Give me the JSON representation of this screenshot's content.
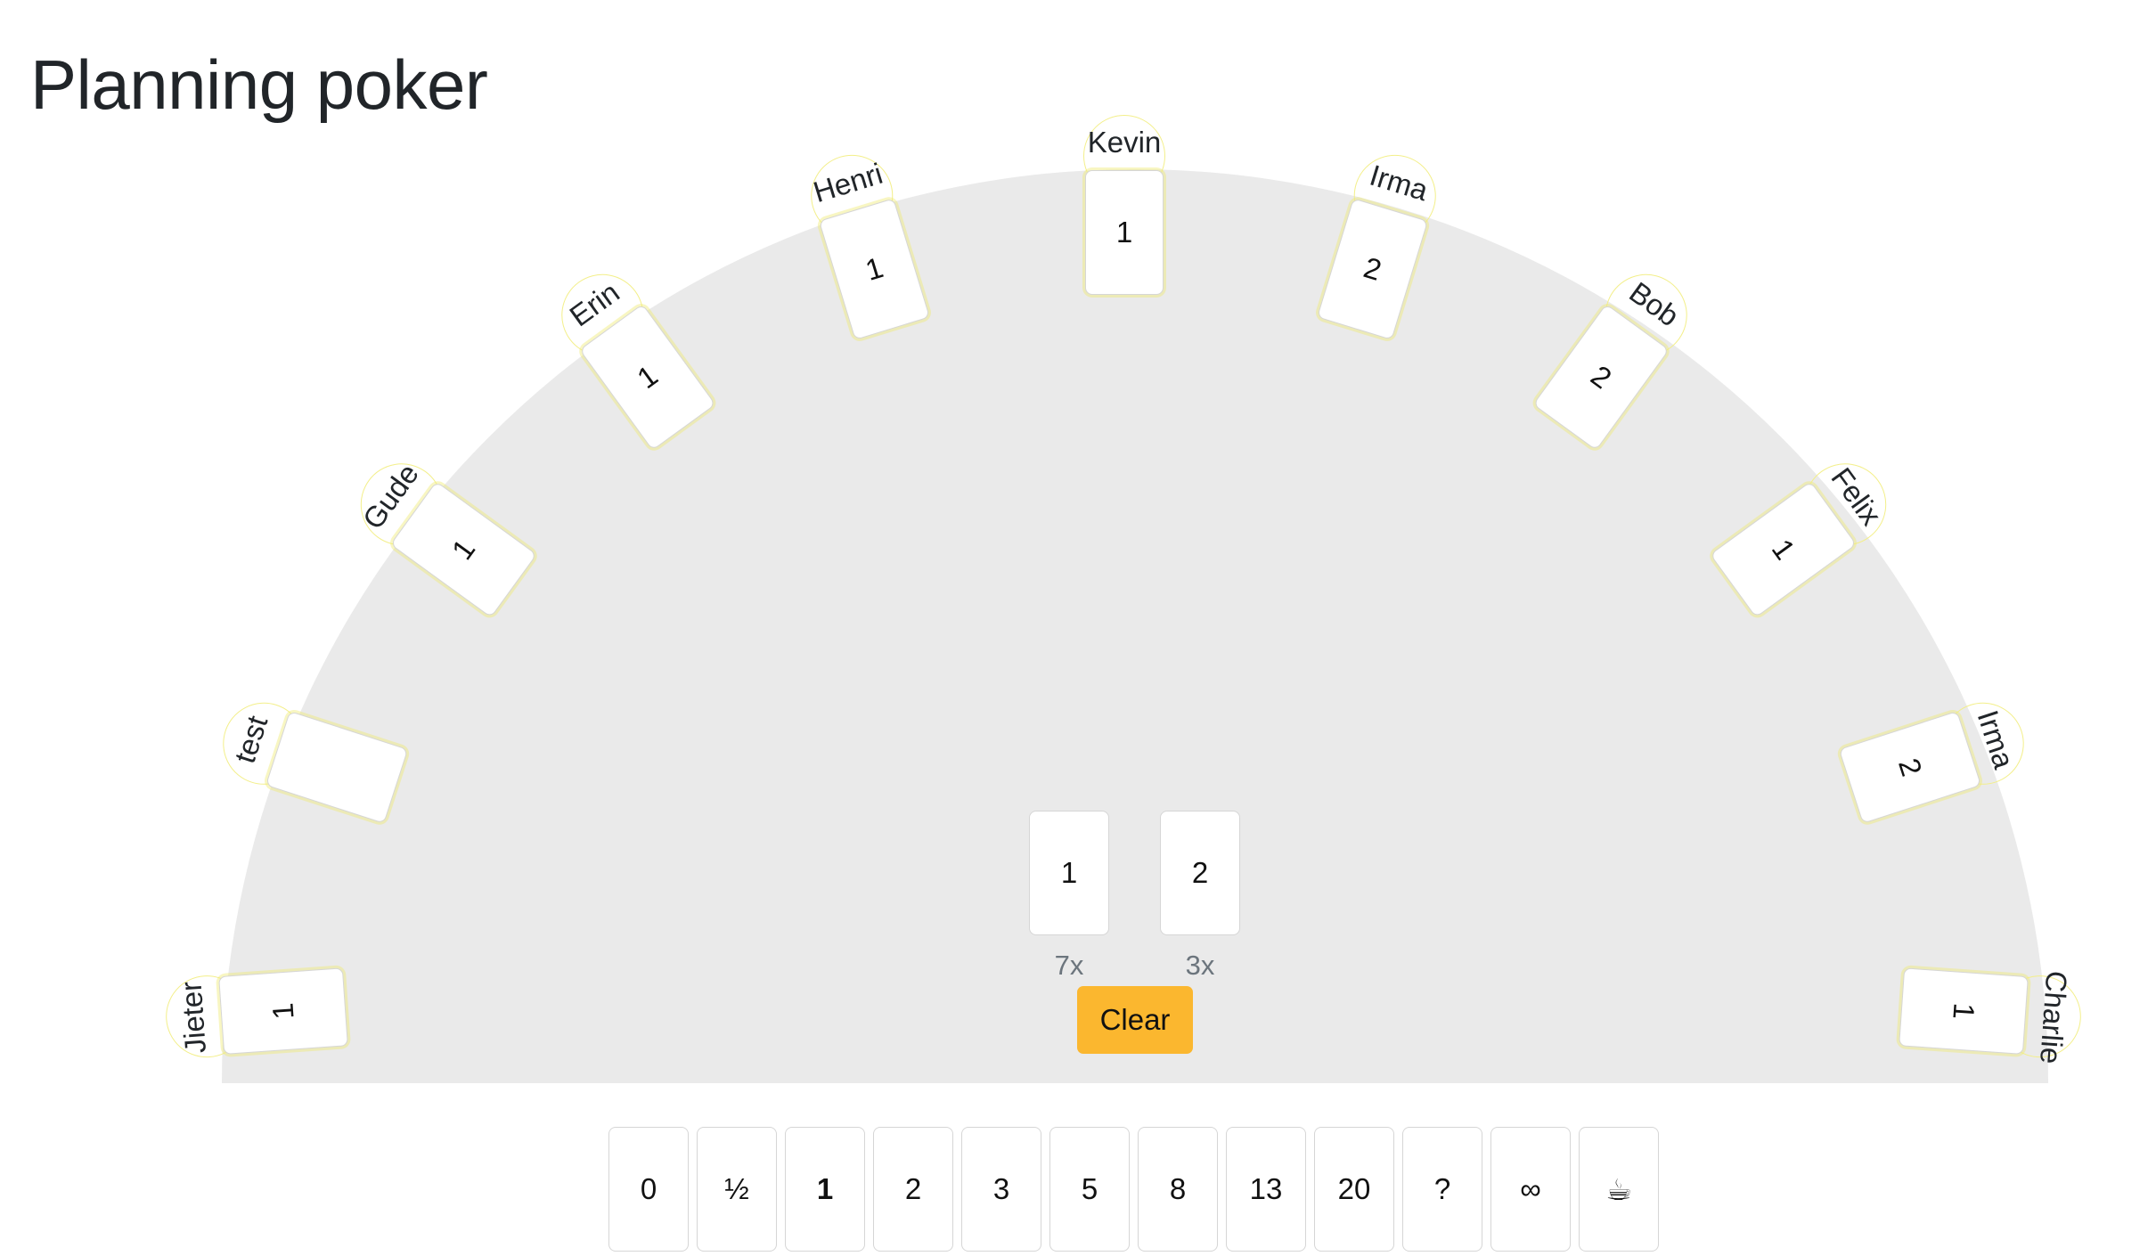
{
  "app": {
    "title": "Planning poker"
  },
  "players": [
    {
      "name": "Jieter",
      "vote": "1"
    },
    {
      "name": "test",
      "vote": ""
    },
    {
      "name": "Gude",
      "vote": "1"
    },
    {
      "name": "Erin",
      "vote": "1"
    },
    {
      "name": "Henri",
      "vote": "1"
    },
    {
      "name": "Kevin",
      "vote": "1"
    },
    {
      "name": "Irma",
      "vote": "2"
    },
    {
      "name": "Bob",
      "vote": "2"
    },
    {
      "name": "Felix",
      "vote": "1"
    },
    {
      "name": "Irma",
      "vote": "2"
    },
    {
      "name": "Charlie",
      "vote": "1"
    }
  ],
  "summary": {
    "results": [
      {
        "value": "1",
        "count": "7x"
      },
      {
        "value": "2",
        "count": "3x"
      }
    ],
    "clear_label": "Clear"
  },
  "deck": {
    "cards": [
      "0",
      "½",
      "1",
      "2",
      "3",
      "5",
      "8",
      "13",
      "20",
      "?",
      "∞",
      "☕"
    ],
    "selected": "1"
  },
  "colors": {
    "table": "#eaeaea",
    "clear_button": "#fbb72f",
    "player_ring": "#f3ef8a",
    "card_border": "#d6d6d6",
    "count_text": "#6c757d"
  }
}
